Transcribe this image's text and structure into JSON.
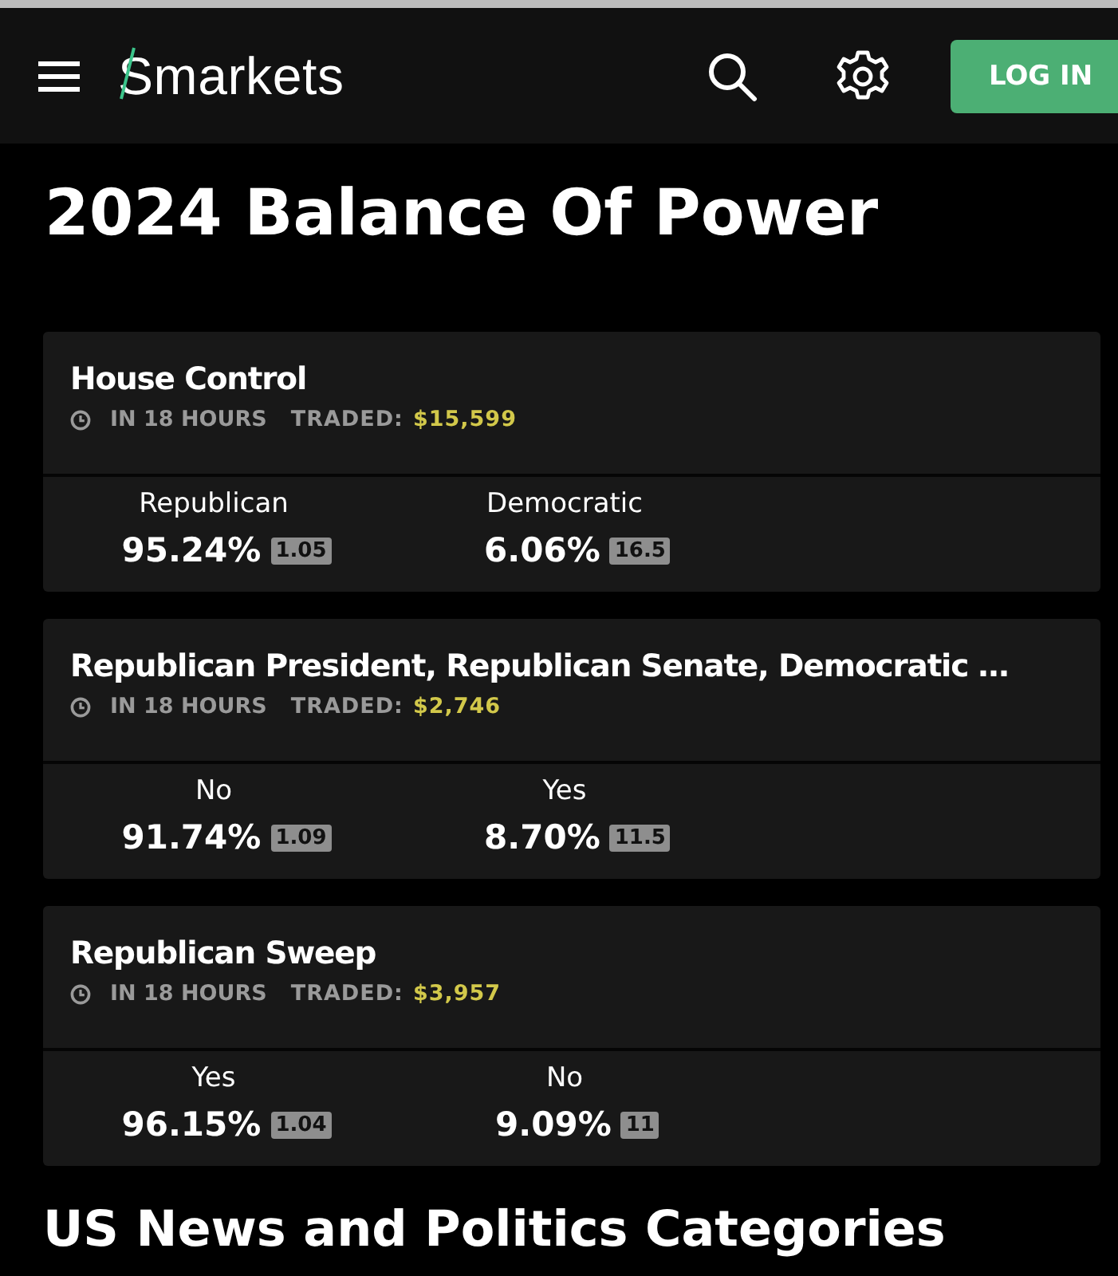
{
  "header": {
    "logo": "Smarkets",
    "login": "LOG IN"
  },
  "title": "2024 Balance Of Power",
  "markets": [
    {
      "name": "House Control",
      "time": "IN 18 HOURS",
      "traded_label": "TRADED:",
      "traded": "$15,599",
      "outcomes": [
        {
          "name": "Republican",
          "percent": "95.24%",
          "odds": "1.05"
        },
        {
          "name": "Democratic",
          "percent": "6.06%",
          "odds": "16.5"
        }
      ]
    },
    {
      "name": "Republican President, Republican Senate, Democratic …",
      "time": "IN 18 HOURS",
      "traded_label": "TRADED:",
      "traded": "$2,746",
      "outcomes": [
        {
          "name": "No",
          "percent": "91.74%",
          "odds": "1.09"
        },
        {
          "name": "Yes",
          "percent": "8.70%",
          "odds": "11.5"
        }
      ]
    },
    {
      "name": "Republican Sweep",
      "time": "IN 18 HOURS",
      "traded_label": "TRADED:",
      "traded": "$3,957",
      "outcomes": [
        {
          "name": "Yes",
          "percent": "96.15%",
          "odds": "1.04"
        },
        {
          "name": "No",
          "percent": "9.09%",
          "odds": "11"
        }
      ]
    }
  ],
  "section_heading": "US News and Politics Categories"
}
